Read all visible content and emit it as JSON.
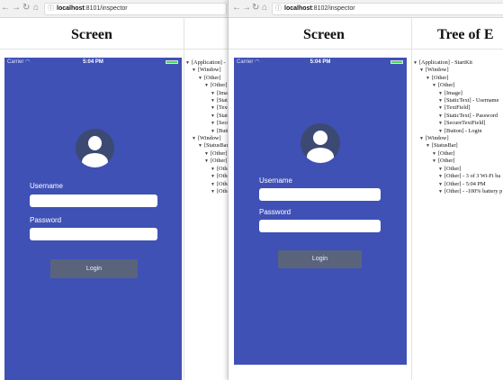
{
  "colors": {
    "phone_bg": "#3f51b5",
    "login_button": "#59647c",
    "battery": "#4cd964"
  },
  "left_window": {
    "url_prefix": "localhost",
    "url_rest": ":8101/inspector",
    "screen_heading": "Screen",
    "status": {
      "carrier": "Carrier",
      "time": "5:04 PM"
    },
    "username_label": "Username",
    "password_label": "Password",
    "login_label": "Login",
    "tree": [
      {
        "text": "[Application] - ",
        "depth": 0
      },
      {
        "text": "[Window]",
        "depth": 1
      },
      {
        "text": "[Other]",
        "depth": 2
      },
      {
        "text": "[Other]",
        "depth": 3
      },
      {
        "text": "[Image",
        "depth": 4
      },
      {
        "text": "[Static",
        "depth": 4
      },
      {
        "text": "[Text",
        "depth": 4
      },
      {
        "text": "[Stati",
        "depth": 4
      },
      {
        "text": "[Secur",
        "depth": 4
      },
      {
        "text": "[Butt",
        "depth": 4
      },
      {
        "text": "[Window]",
        "depth": 1
      },
      {
        "text": "[StatusBar]",
        "depth": 2
      },
      {
        "text": "[Other]",
        "depth": 3
      },
      {
        "text": "[Other]",
        "depth": 3
      },
      {
        "text": "[Othe",
        "depth": 4
      },
      {
        "text": "[Othe",
        "depth": 4
      },
      {
        "text": "[Othe",
        "depth": 4
      },
      {
        "text": "[Othe",
        "depth": 4
      }
    ]
  },
  "right_window": {
    "url_prefix": "localhost",
    "url_rest": ":8102/inspector",
    "screen_heading": "Screen",
    "tree_heading": "Tree of E",
    "status": {
      "carrier": "Carrier",
      "time": "5:04 PM"
    },
    "username_label": "Username",
    "password_label": "Password",
    "login_label": "Login",
    "tree": [
      {
        "text": "[Application] - StartKit",
        "depth": 0
      },
      {
        "text": "[Window]",
        "depth": 1
      },
      {
        "text": "[Other]",
        "depth": 2
      },
      {
        "text": "[Other]",
        "depth": 3
      },
      {
        "text": "[Image]",
        "depth": 4
      },
      {
        "text": "[StaticText] - Username",
        "depth": 4
      },
      {
        "text": "[TextField]",
        "depth": 4
      },
      {
        "text": "[StaticText] - Password",
        "depth": 4
      },
      {
        "text": "[SecureTextField]",
        "depth": 4
      },
      {
        "text": "[Button] - Login",
        "depth": 4
      },
      {
        "text": "[Window]",
        "depth": 1
      },
      {
        "text": "[StatusBar]",
        "depth": 2
      },
      {
        "text": "[Other]",
        "depth": 3
      },
      {
        "text": "[Other]",
        "depth": 3
      },
      {
        "text": "[Other]",
        "depth": 4
      },
      {
        "text": "[Other] - 3 of 3 Wi-Fi ba",
        "depth": 4
      },
      {
        "text": "[Other] - 5:04 PM",
        "depth": 4
      },
      {
        "text": "[Other] - -100% battery p",
        "depth": 4
      }
    ]
  }
}
